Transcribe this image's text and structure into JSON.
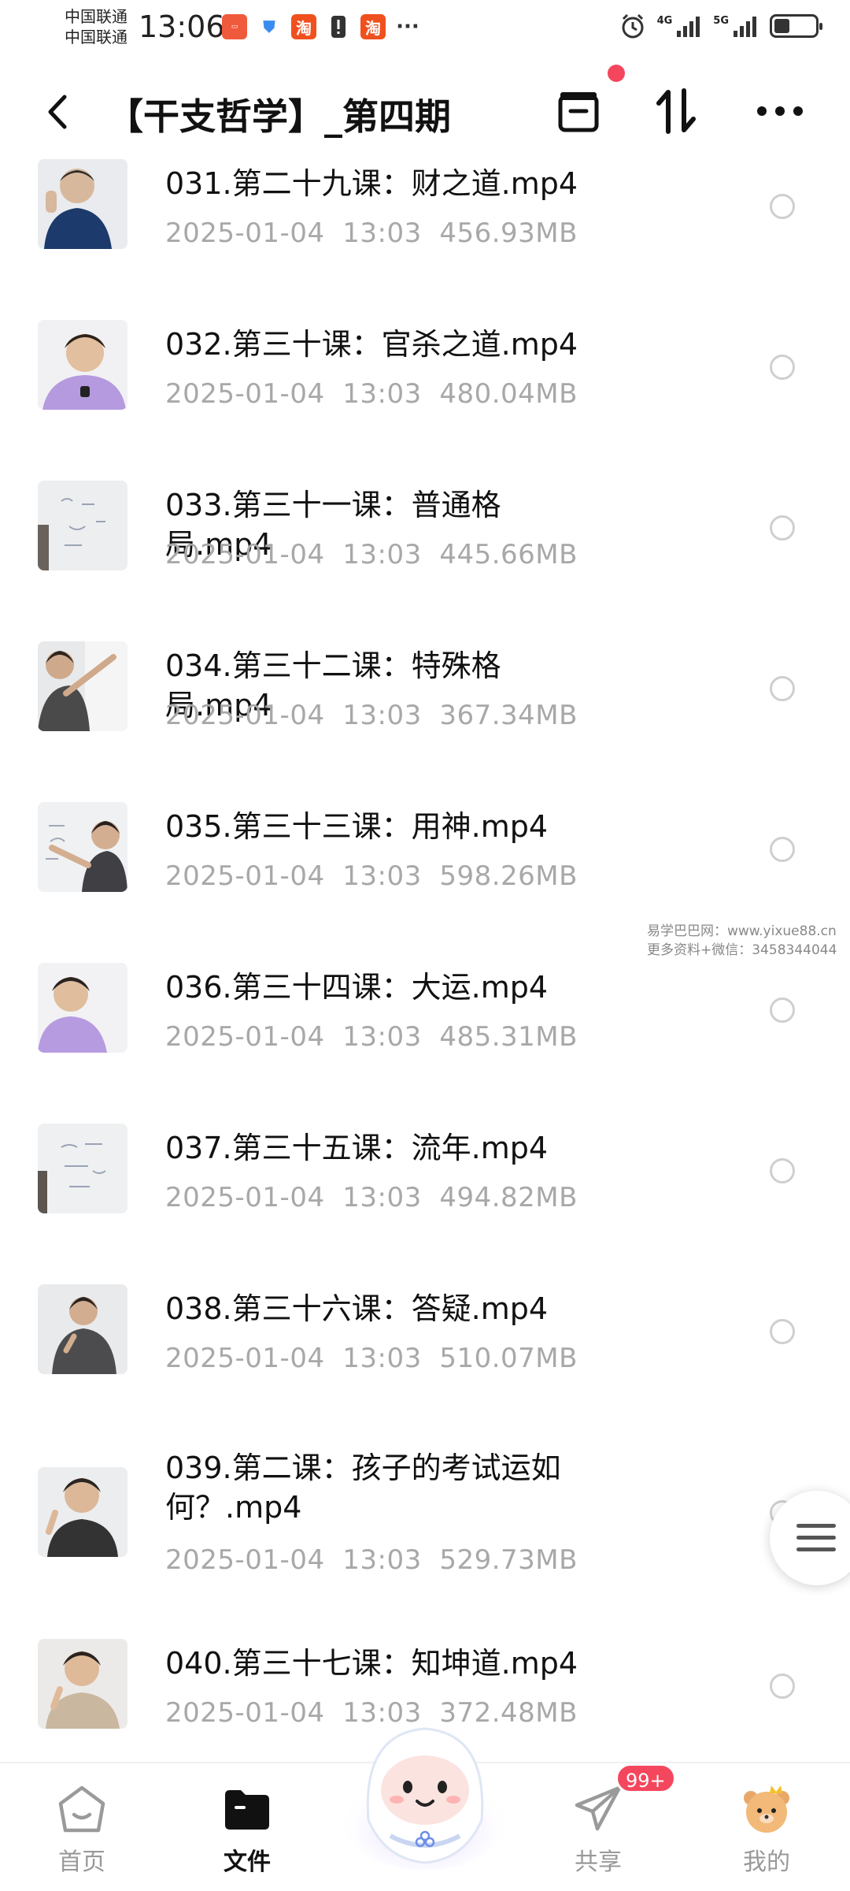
{
  "status_bar": {
    "carrier_1": "中国联通",
    "carrier_2": "中国联通",
    "time": "13:06",
    "network_1": "4G",
    "network_2": "5G"
  },
  "header": {
    "title": "【干支哲学】_第四期"
  },
  "files": [
    {
      "name": "031.第二十九课：财之道.mp4",
      "date": "2025-01-04",
      "time": "13:03",
      "size": "456.93MB"
    },
    {
      "name": "032.第三十课：官杀之道.mp4",
      "date": "2025-01-04",
      "time": "13:03",
      "size": "480.04MB"
    },
    {
      "name": "033.第三十一课：普通格局.mp4",
      "date": "2025-01-04",
      "time": "13:03",
      "size": "445.66MB"
    },
    {
      "name": "034.第三十二课：特殊格局.mp4",
      "date": "2025-01-04",
      "time": "13:03",
      "size": "367.34MB"
    },
    {
      "name": "035.第三十三课：用神.mp4",
      "date": "2025-01-04",
      "time": "13:03",
      "size": "598.26MB"
    },
    {
      "name": "036.第三十四课：大运.mp4",
      "date": "2025-01-04",
      "time": "13:03",
      "size": "485.31MB"
    },
    {
      "name": "037.第三十五课：流年.mp4",
      "date": "2025-01-04",
      "time": "13:03",
      "size": "494.82MB"
    },
    {
      "name": "038.第三十六课：答疑.mp4",
      "date": "2025-01-04",
      "time": "13:03",
      "size": "510.07MB"
    },
    {
      "name": "039.第二课：孩子的考试运如何？.mp4",
      "date": "2025-01-04",
      "time": "13:03",
      "size": "529.73MB"
    },
    {
      "name": "040.第三十七课：知坤道.mp4",
      "date": "2025-01-04",
      "time": "13:03",
      "size": "372.48MB"
    }
  ],
  "watermark": {
    "line1": "易学巴巴网：www.yixue88.cn",
    "line2": "更多资料+微信：3458344044"
  },
  "bottom_nav": {
    "home": "首页",
    "files": "文件",
    "share": "共享",
    "mine": "我的",
    "share_badge": "99+"
  }
}
